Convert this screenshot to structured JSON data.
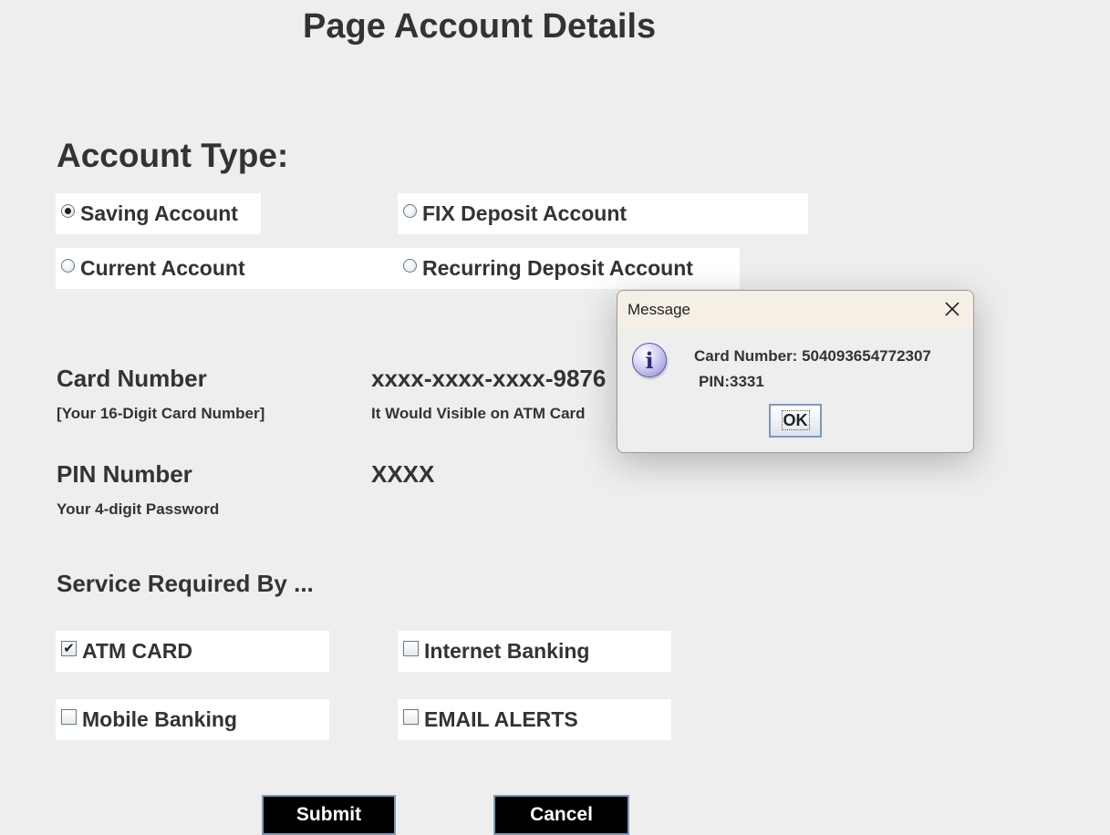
{
  "page": {
    "title": "Page Account Details"
  },
  "account_type": {
    "heading": "Account Type:",
    "options": [
      {
        "label": "Saving Account",
        "checked": true
      },
      {
        "label": "FIX Deposit Account",
        "checked": false
      },
      {
        "label": "Current Account",
        "checked": false
      },
      {
        "label": "Recurring Deposit Account",
        "checked": false
      }
    ]
  },
  "card": {
    "label": "Card Number",
    "sublabel": "[Your 16-Digit Card Number]",
    "value": "xxxx-xxxx-xxxx-9876",
    "value_note": "It Would Visible on ATM Card"
  },
  "pin": {
    "label": "PIN Number",
    "sublabel": "Your 4-digit Password",
    "value": "XXXX"
  },
  "services": {
    "heading": "Service Required By ...",
    "options": [
      {
        "label": "ATM CARD",
        "checked": true
      },
      {
        "label": "Internet Banking",
        "checked": false
      },
      {
        "label": "Mobile Banking",
        "checked": false
      },
      {
        "label": "EMAIL ALERTS",
        "checked": false
      }
    ]
  },
  "buttons": {
    "submit": "Submit",
    "cancel": "Cancel"
  },
  "dialog": {
    "title": "Message",
    "icon": "info-icon",
    "line1": "Card Number: 504093654772307",
    "line2": "PIN:3331",
    "ok": "OK"
  }
}
